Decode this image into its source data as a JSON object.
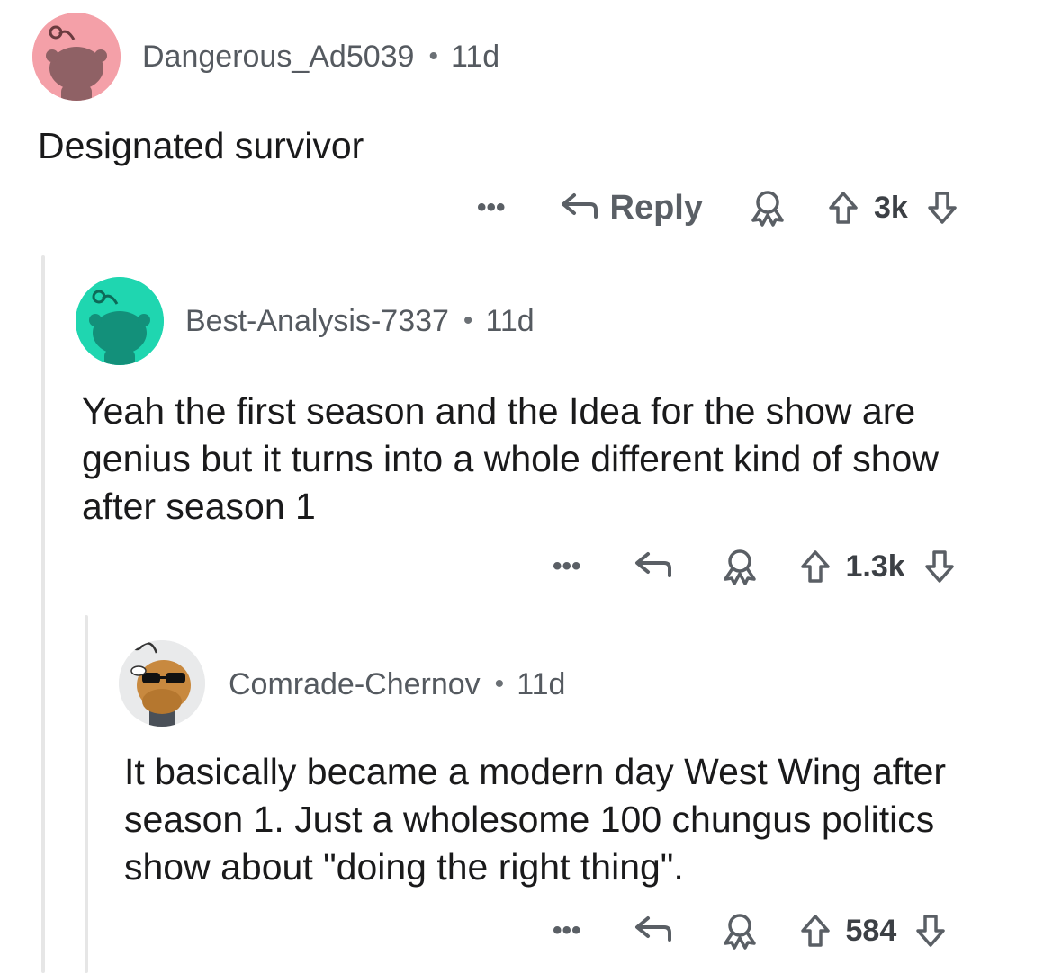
{
  "comments": [
    {
      "username": "Dangerous_Ad5039",
      "age": "11d",
      "body": "Designated survivor",
      "reply_label": "Reply",
      "votes": "3k",
      "more_label": "•••",
      "avatar_color": "#f4a0a8"
    },
    {
      "username": "Best-Analysis-7337",
      "age": "11d",
      "body": "Yeah the first season and the Idea for the show are genius but it turns into a whole different kind of show after season 1",
      "votes": "1.3k",
      "more_label": "•••",
      "avatar_color": "#1fd6b0"
    },
    {
      "username": "Comrade-Chernov",
      "age": "11d",
      "body": "It basically became a modern day West Wing after season 1. Just a wholesome 100 chungus politics show about \"doing the right thing\".",
      "votes": "584",
      "more_label": "•••",
      "avatar_color": "#e9eaeb"
    }
  ],
  "separator": "•",
  "icons": {
    "reply": "reply-arrow-icon",
    "award": "award-icon",
    "upvote": "upvote-arrow-icon",
    "downvote": "downvote-arrow-icon",
    "more": "more-options-icon"
  }
}
